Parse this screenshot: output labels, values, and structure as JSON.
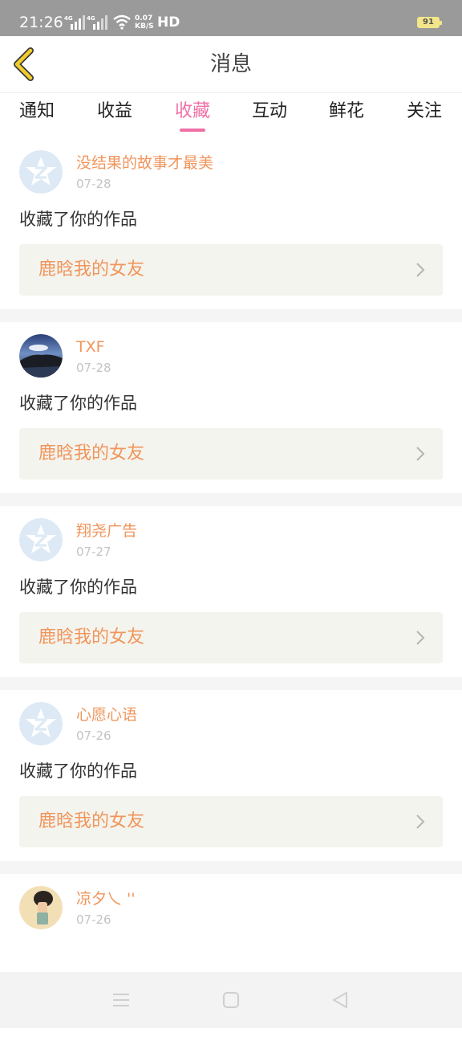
{
  "status_bar": {
    "time": "21:26",
    "speed_value": "0.07",
    "speed_unit": "KB/S",
    "hd": "HD",
    "battery": "91",
    "battery_level": 0.91
  },
  "header": {
    "title": "消息"
  },
  "tabs": [
    {
      "label": "通知"
    },
    {
      "label": "收益"
    },
    {
      "label": "收藏",
      "active": true
    },
    {
      "label": "互动"
    },
    {
      "label": "鲜花"
    },
    {
      "label": "关注"
    }
  ],
  "messages": [
    {
      "user": "没结果的故事才最美",
      "date": "07-28",
      "action": "收藏了你的作品",
      "work": "鹿晗我的女友",
      "avatar": "default-avatar-icon"
    },
    {
      "user": "TXF",
      "date": "07-28",
      "action": "收藏了你的作品",
      "work": "鹿晗我的女友",
      "avatar": "landscape-photo-avatar"
    },
    {
      "user": "翔尧广告",
      "date": "07-27",
      "action": "收藏了你的作品",
      "work": "鹿晗我的女友",
      "avatar": "default-avatar-icon"
    },
    {
      "user": "心愿心语",
      "date": "07-26",
      "action": "收藏了你的作品",
      "work": "鹿晗我的女友",
      "avatar": "default-avatar-icon"
    },
    {
      "user": "凉夕乀 ''",
      "date": "07-26",
      "avatar": "figure-photo-avatar"
    }
  ],
  "colors": {
    "accent_pink": "#ef6fa6",
    "accent_orange": "#f0955c",
    "back_arrow": "#f1cc2b",
    "status_bar": "#9a9a9a"
  }
}
